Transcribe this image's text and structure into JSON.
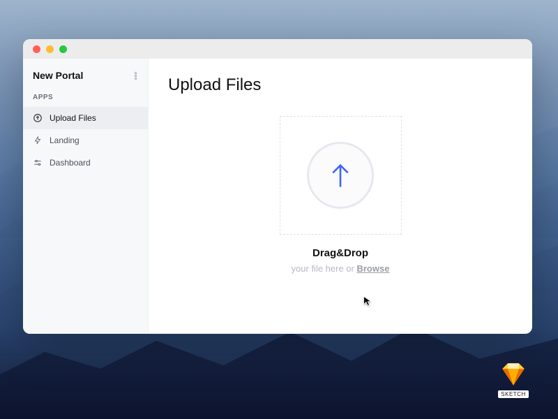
{
  "sidebar": {
    "title": "New Portal",
    "section_label": "APPS",
    "items": [
      {
        "label": "Upload Files",
        "active": true
      },
      {
        "label": "Landing",
        "active": false
      },
      {
        "label": "Dashboard",
        "active": false
      }
    ]
  },
  "main": {
    "heading": "Upload Files",
    "drop_heading": "Drag&Drop",
    "drop_sub_prefix": "your file here or ",
    "browse_label": "Browse"
  },
  "desktop_file": {
    "label": "SKETCH"
  }
}
